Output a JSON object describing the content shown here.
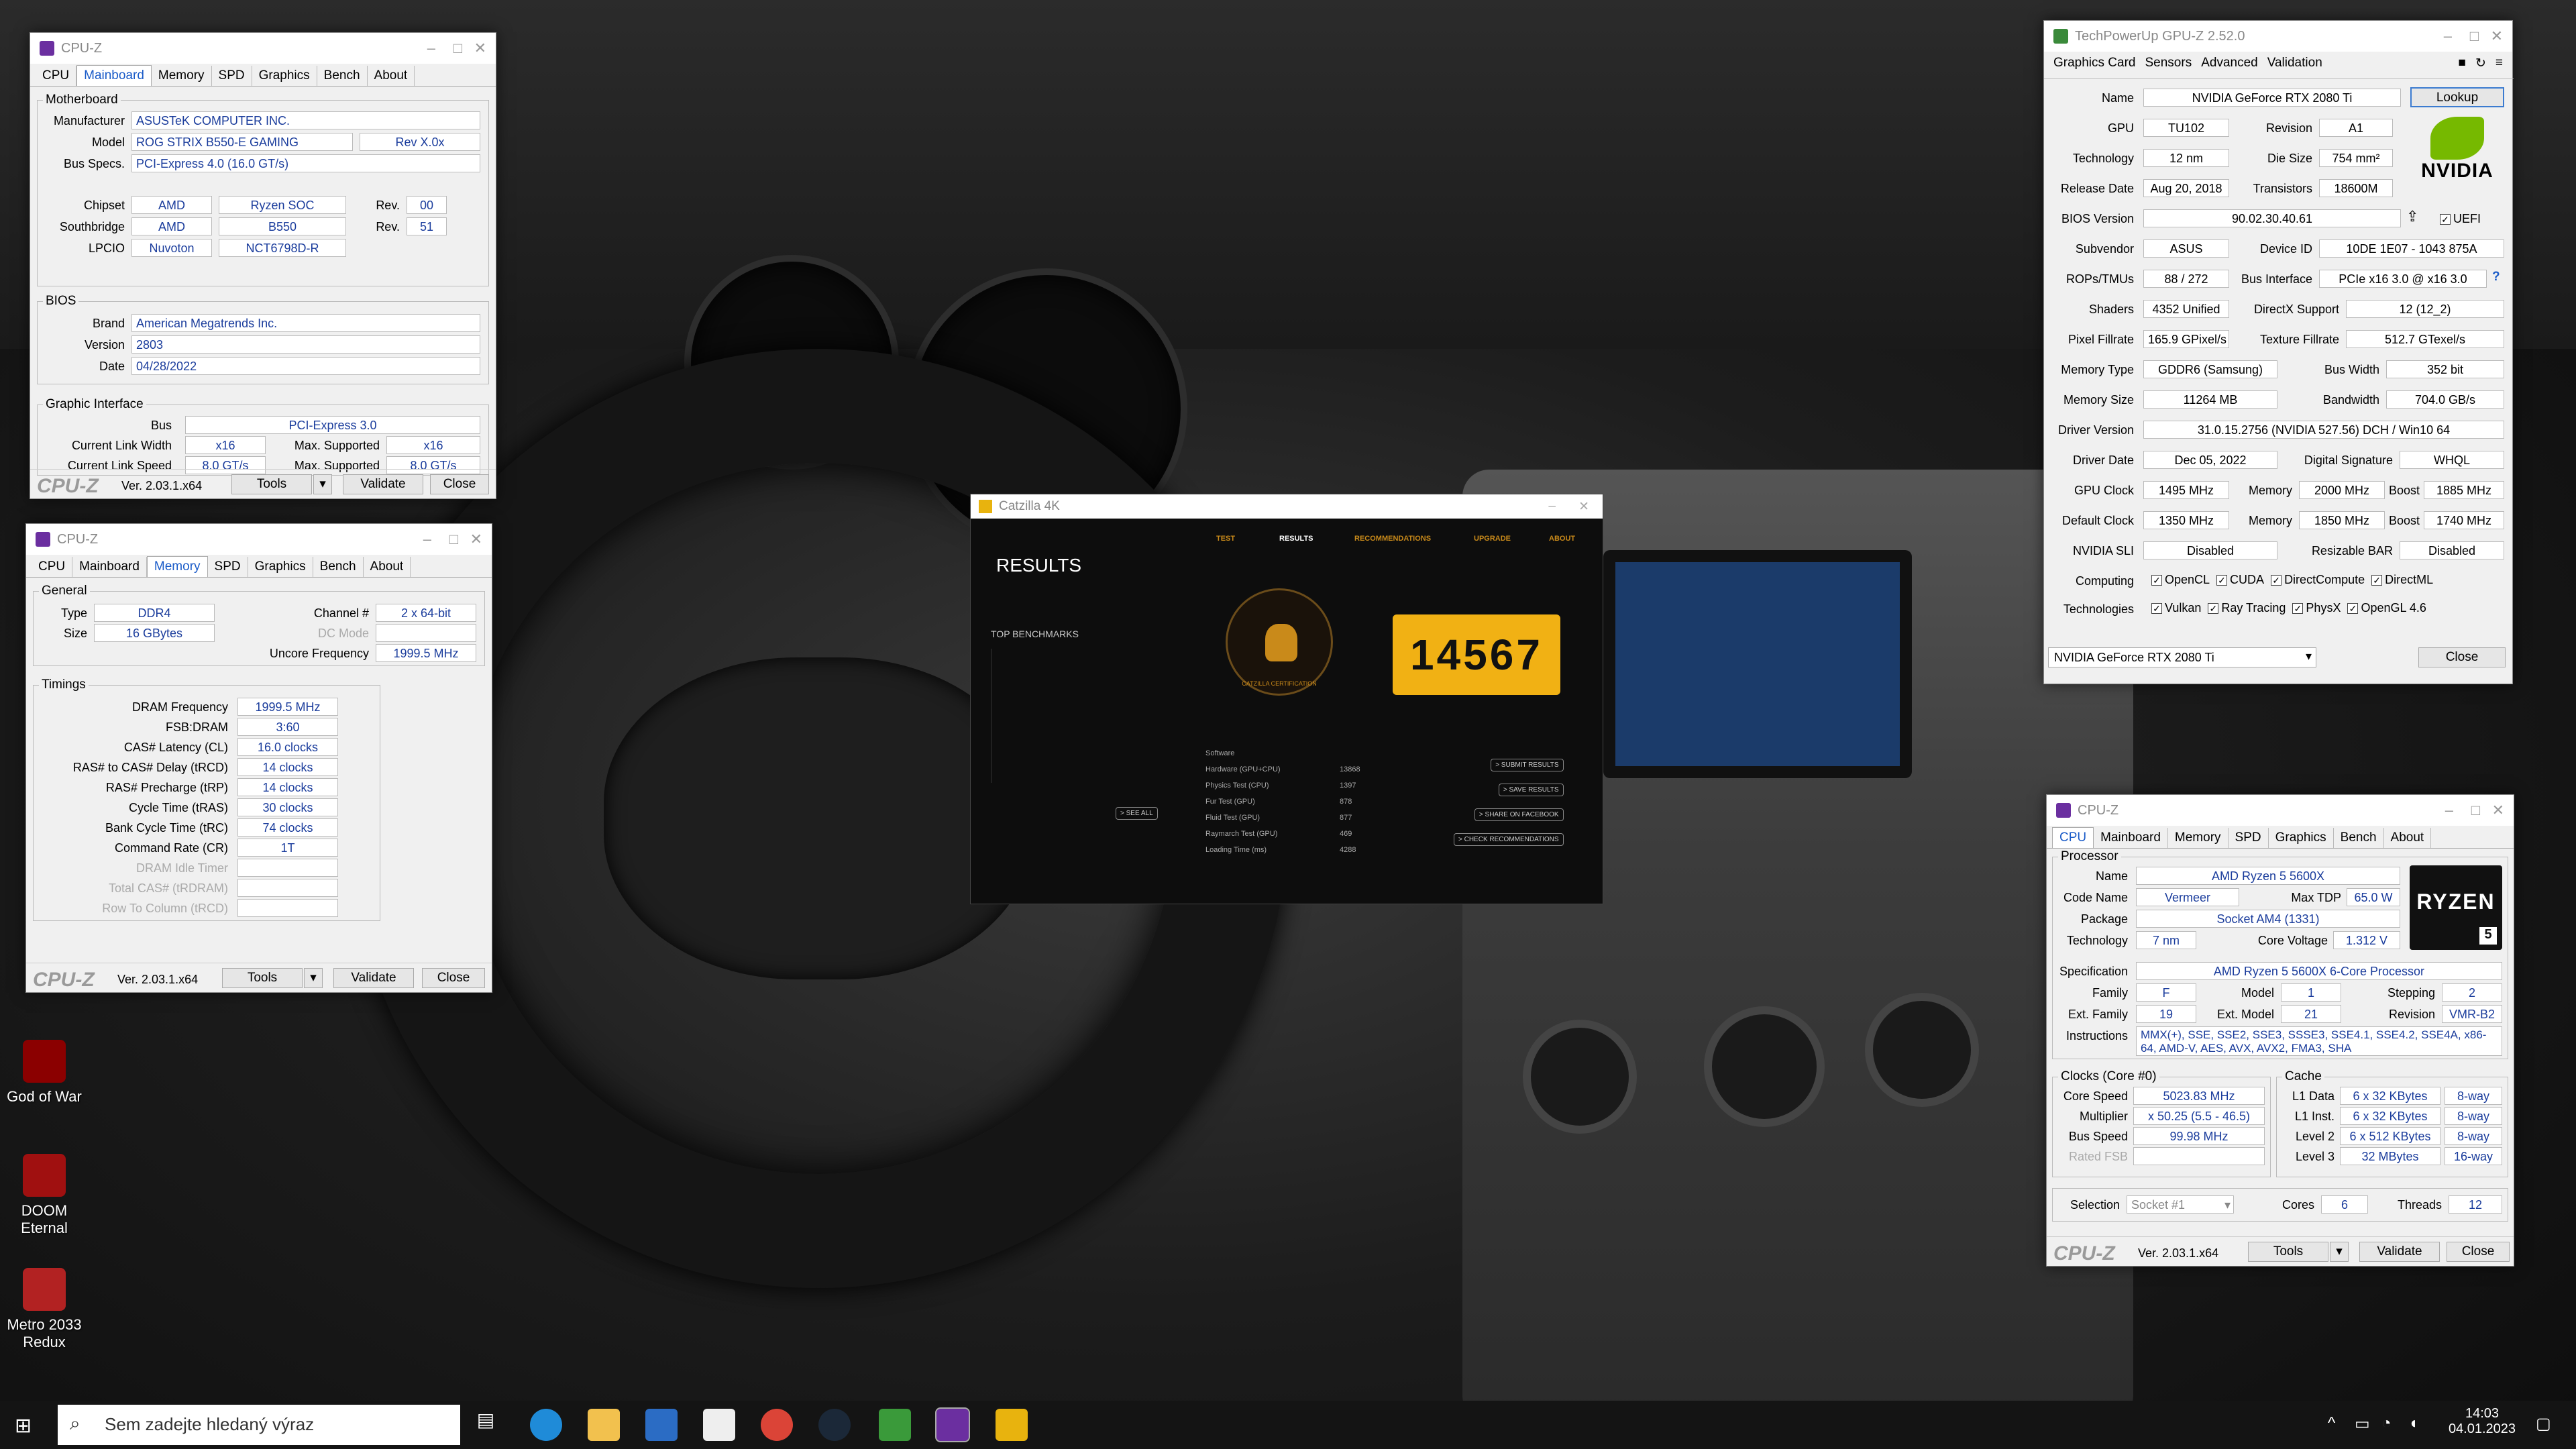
{
  "taskbar": {
    "search_placeholder": "Sem zadejte hledaný výraz",
    "time": "14:03",
    "date": "04.01.2023"
  },
  "desktop_icons": [
    {
      "label": "God of War"
    },
    {
      "label": "DOOM Eternal"
    },
    {
      "label": "Metro 2033 Redux"
    }
  ],
  "cpuz_mainboard": {
    "title": "CPU-Z",
    "tabs": [
      "CPU",
      "Mainboard",
      "Memory",
      "SPD",
      "Graphics",
      "Bench",
      "About"
    ],
    "active_tab": "Mainboard",
    "group_motherboard": "Motherboard",
    "labels": {
      "manufacturer": "Manufacturer",
      "model": "Model",
      "bus_specs": "Bus Specs.",
      "chipset": "Chipset",
      "southbridge": "Southbridge",
      "lpcio": "LPCIO",
      "rev": "Rev."
    },
    "manufacturer": "ASUSTeK COMPUTER INC.",
    "model": "ROG STRIX B550-E GAMING",
    "model_rev": "Rev X.0x",
    "bus_specs": "PCI-Express 4.0 (16.0 GT/s)",
    "chipset_vendor": "AMD",
    "chipset_name": "Ryzen SOC",
    "chipset_rev": "00",
    "sb_vendor": "AMD",
    "sb_name": "B550",
    "sb_rev": "51",
    "lpcio_vendor": "Nuvoton",
    "lpcio_name": "NCT6798D-R",
    "group_bios": "BIOS",
    "bios_labels": {
      "brand": "Brand",
      "version": "Version",
      "date": "Date"
    },
    "bios_brand": "American Megatrends Inc.",
    "bios_version": "2803",
    "bios_date": "04/28/2022",
    "group_gi": "Graphic Interface",
    "gi_labels": {
      "bus": "Bus",
      "link_width": "Current Link Width",
      "link_speed": "Current Link Speed",
      "max_supported": "Max. Supported"
    },
    "gi_bus": "PCI-Express 3.0",
    "gi_width": "x16",
    "gi_width_max": "x16",
    "gi_speed": "8.0 GT/s",
    "gi_speed_max": "8.0 GT/s",
    "brand": "CPU-Z",
    "version": "Ver. 2.03.1.x64",
    "tools": "Tools",
    "validate": "Validate",
    "close": "Close"
  },
  "cpuz_memory": {
    "title": "CPU-Z",
    "active_tab": "Memory",
    "group_general": "General",
    "labels": {
      "type": "Type",
      "size": "Size",
      "channel": "Channel #",
      "dc_mode": "DC Mode",
      "uncore": "Uncore Frequency"
    },
    "type": "DDR4",
    "size": "16 GBytes",
    "channel": "2 x 64-bit",
    "uncore": "1999.5 MHz",
    "group_timings": "Timings",
    "timings": [
      {
        "label": "DRAM Frequency",
        "value": "1999.5 MHz"
      },
      {
        "label": "FSB:DRAM",
        "value": "3:60"
      },
      {
        "label": "CAS# Latency (CL)",
        "value": "16.0 clocks"
      },
      {
        "label": "RAS# to CAS# Delay (tRCD)",
        "value": "14 clocks"
      },
      {
        "label": "RAS# Precharge (tRP)",
        "value": "14 clocks"
      },
      {
        "label": "Cycle Time (tRAS)",
        "value": "30 clocks"
      },
      {
        "label": "Bank Cycle Time (tRC)",
        "value": "74 clocks"
      },
      {
        "label": "Command Rate (CR)",
        "value": "1T"
      },
      {
        "label": "DRAM Idle Timer",
        "value": ""
      },
      {
        "label": "Total CAS# (tRDRAM)",
        "value": ""
      },
      {
        "label": "Row To Column (tRCD)",
        "value": ""
      }
    ],
    "brand": "CPU-Z",
    "version": "Ver. 2.03.1.x64",
    "tools": "Tools",
    "validate": "Validate",
    "close": "Close"
  },
  "gpuz": {
    "title": "TechPowerUp GPU-Z 2.52.0",
    "tabs": [
      "Graphics Card",
      "Sensors",
      "Advanced",
      "Validation"
    ],
    "rows": {
      "name_l": "Name",
      "name": "NVIDIA GeForce RTX 2080 Ti",
      "lookup": "Lookup",
      "gpu_l": "GPU",
      "gpu": "TU102",
      "rev_l": "Revision",
      "rev": "A1",
      "tech_l": "Technology",
      "tech": "12 nm",
      "die_l": "Die Size",
      "die": "754 mm²",
      "rel_l": "Release Date",
      "rel": "Aug 20, 2018",
      "trans_l": "Transistors",
      "trans": "18600M",
      "bios_l": "BIOS Version",
      "bios": "90.02.30.40.61",
      "uefi": "UEFI",
      "subv_l": "Subvendor",
      "subv": "ASUS",
      "devid_l": "Device ID",
      "devid": "10DE 1E07 - 1043 875A",
      "rops_l": "ROPs/TMUs",
      "rops": "88 / 272",
      "busif_l": "Bus Interface",
      "busif": "PCIe x16 3.0 @ x16 3.0",
      "shaders_l": "Shaders",
      "shaders": "4352 Unified",
      "dx_l": "DirectX Support",
      "dx": "12 (12_2)",
      "pf_l": "Pixel Fillrate",
      "pf": "165.9 GPixel/s",
      "tf_l": "Texture Fillrate",
      "tf": "512.7 GTexel/s",
      "mt_l": "Memory Type",
      "mt": "GDDR6 (Samsung)",
      "bw_l": "Bus Width",
      "bw": "352 bit",
      "ms_l": "Memory Size",
      "ms": "11264 MB",
      "band_l": "Bandwidth",
      "band": "704.0 GB/s",
      "dv_l": "Driver Version",
      "dv": "31.0.15.2756 (NVIDIA 527.56) DCH / Win10 64",
      "dd_l": "Driver Date",
      "dd": "Dec 05, 2022",
      "ds_l": "Digital Signature",
      "ds": "WHQL",
      "gc_l": "GPU Clock",
      "gc": "1495 MHz",
      "mem_l": "Memory",
      "gm": "2000 MHz",
      "boost_l": "Boost",
      "gb": "1885 MHz",
      "dc_l": "Default Clock",
      "dc": "1350 MHz",
      "dm": "1850 MHz",
      "db": "1740 MHz",
      "sli_l": "NVIDIA SLI",
      "sli": "Disabled",
      "rbar_l": "Resizable BAR",
      "rbar": "Disabled",
      "comp_l": "Computing",
      "tech2_l": "Technologies"
    },
    "computing": [
      "OpenCL",
      "CUDA",
      "DirectCompute",
      "DirectML"
    ],
    "technologies": [
      "Vulkan",
      "Ray Tracing",
      "PhysX",
      "OpenGL 4.6"
    ],
    "select": "NVIDIA GeForce RTX 2080 Ti",
    "close": "Close",
    "logo": "NVIDIA"
  },
  "cpuz_cpu": {
    "title": "CPU-Z",
    "active_tab": "CPU",
    "group_processor": "Processor",
    "labels": {
      "name": "Name",
      "code": "Code Name",
      "tdp": "Max TDP",
      "package": "Package",
      "tech": "Technology",
      "volt": "Core Voltage",
      "spec": "Specification",
      "family": "Family",
      "model": "Model",
      "stepping": "Stepping",
      "extfam": "Ext. Family",
      "extmod": "Ext. Model",
      "revision": "Revision",
      "instr": "Instructions"
    },
    "name": "AMD Ryzen 5 5600X",
    "code": "Vermeer",
    "tdp": "65.0 W",
    "package": "Socket AM4 (1331)",
    "tech": "7 nm",
    "volt": "1.312 V",
    "spec": "AMD Ryzen 5 5600X 6-Core Processor",
    "family": "F",
    "model": "1",
    "stepping": "2",
    "extfam": "19",
    "extmod": "21",
    "revision": "VMR-B2",
    "instr": "MMX(+), SSE, SSE2, SSE3, SSSE3, SSE4.1, SSE4.2, SSE4A, x86-64, AMD-V, AES, AVX, AVX2, FMA3, SHA",
    "group_clocks": "Clocks (Core #0)",
    "clock_labels": {
      "core": "Core Speed",
      "mult": "Multiplier",
      "bus": "Bus Speed",
      "fsb": "Rated FSB"
    },
    "core_speed": "5023.83 MHz",
    "mult": "x 50.25 (5.5 - 46.5)",
    "bus": "99.98 MHz",
    "group_cache": "Cache",
    "cache": [
      {
        "l": "L1 Data",
        "v": "6 x 32 KBytes",
        "w": "8-way"
      },
      {
        "l": "L1 Inst.",
        "v": "6 x 32 KBytes",
        "w": "8-way"
      },
      {
        "l": "Level 2",
        "v": "6 x 512 KBytes",
        "w": "8-way"
      },
      {
        "l": "Level 3",
        "v": "32 MBytes",
        "w": "16-way"
      }
    ],
    "sel_l": "Selection",
    "sel": "Socket #1",
    "cores_l": "Cores",
    "cores": "6",
    "threads_l": "Threads",
    "threads": "12",
    "brand": "CPU-Z",
    "version": "Ver. 2.03.1.x64",
    "tools": "Tools",
    "validate": "Validate",
    "close": "Close",
    "logo_top": "RYZEN",
    "logo_num": "5"
  },
  "catzilla": {
    "title": "Catzilla 4K",
    "nav": [
      "TEST",
      "RESULTS",
      "RECOMMENDATIONS",
      "UPGRADE",
      "ABOUT"
    ],
    "heading": "RESULTS",
    "top": "TOP BENCHMARKS",
    "see_all": "> SEE ALL",
    "score": "14567",
    "cert": "CATZILLA CERTIFICATION",
    "rows": [
      {
        "l": "Software",
        "v": ""
      },
      {
        "l": "Hardware (GPU+CPU)",
        "v": "13868"
      },
      {
        "l": "Physics Test (CPU)",
        "v": "1397"
      },
      {
        "l": "Fur Test (GPU)",
        "v": "878"
      },
      {
        "l": "Fluid Test (GPU)",
        "v": "877"
      },
      {
        "l": "Raymarch Test (GPU)",
        "v": "469"
      },
      {
        "l": "Loading Time (ms)",
        "v": "4288"
      }
    ],
    "buttons": [
      "> SUBMIT RESULTS",
      "> SAVE RESULTS",
      "> SHARE ON FACEBOOK",
      "> CHECK RECOMMENDATIONS"
    ]
  }
}
